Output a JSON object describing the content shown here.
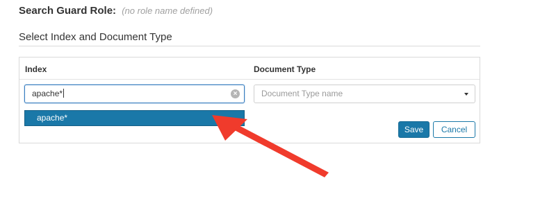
{
  "role": {
    "label": "Search Guard Role:",
    "placeholder": "(no role name defined)"
  },
  "section": {
    "title": "Select Index and Document Type"
  },
  "table": {
    "index_header": "Index",
    "doc_type_header": "Document Type"
  },
  "index_input": {
    "value": "apache*"
  },
  "index_suggestions": [
    "apache*"
  ],
  "doc_type_select": {
    "placeholder": "Document Type name"
  },
  "buttons": {
    "save": "Save",
    "cancel": "Cancel"
  },
  "colors": {
    "primary": "#1a78a8",
    "annotation_arrow": "#f03b2c"
  }
}
